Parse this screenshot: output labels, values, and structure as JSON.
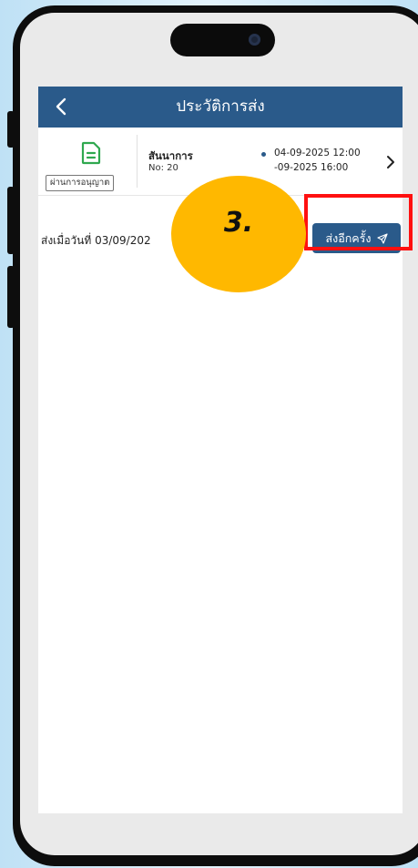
{
  "header": {
    "title": "ประวัติการส่ง",
    "back_icon": "chevron-left-icon"
  },
  "history_item": {
    "status": "ผ่านการอนุญาต",
    "store_name": "สันนาการ",
    "doc_no": "No: 20",
    "start_datetime": "04-09-2025 12:00",
    "end_datetime": "-09-2025 16:00",
    "doc_icon": "document-icon",
    "chevron_icon": "chevron-right-icon"
  },
  "sent_row": {
    "sent_label": "ส่งเมื่อวันที่ 03/09/202",
    "resend_label": "ส่งอีกครั้ง",
    "send_icon": "send-icon"
  },
  "annotation": {
    "step": "3.",
    "colors": {
      "circle": "#ffb800",
      "highlight": "#ff1010"
    }
  },
  "colors": {
    "primary": "#2a5a8a",
    "accent_green": "#2fa84f",
    "background": "#cfe8f7"
  }
}
